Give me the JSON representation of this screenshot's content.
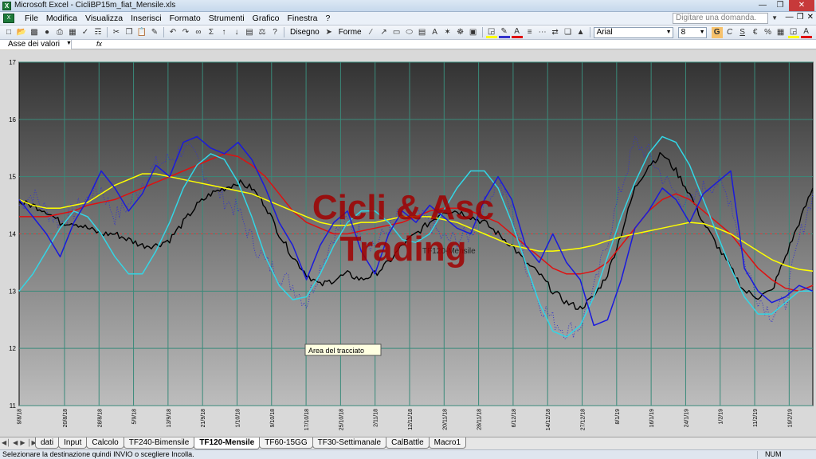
{
  "window": {
    "title": "Microsoft Excel - CicliBP15m_fiat_Mensile.xls"
  },
  "menu": [
    "File",
    "Modifica",
    "Visualizza",
    "Inserisci",
    "Formato",
    "Strumenti",
    "Grafico",
    "Finestra",
    "?"
  ],
  "help_box": {
    "placeholder": "Digitare una domanda."
  },
  "toolbar": {
    "draw_label": "Disegno",
    "shapes_label": "Forme",
    "font_name": "Arial",
    "font_size": "8"
  },
  "namebox": {
    "value": "Asse dei valori"
  },
  "formula": {
    "fx": "fx"
  },
  "chart": {
    "watermark_line1": "Cicli & Asc",
    "watermark_line2": "Trading",
    "tooltip": "Area del tracciato",
    "hidden_label": "TF120-Mensile",
    "reference_level": 14,
    "colors": {
      "price": "#000000",
      "dotted": "#3333cc",
      "red": "#e01010",
      "yellow": "#ffff00",
      "cyan": "#33d6e6",
      "blue": "#1a1adc",
      "watermark": "#a00000"
    }
  },
  "chart_data": {
    "type": "line",
    "ylim": [
      11,
      17
    ],
    "y_ticks": [
      "11",
      "12",
      "13",
      "14",
      "15",
      "16",
      "17"
    ],
    "x_ticks": [
      "9/8/18",
      "20/8/18",
      "28/8/18",
      "5/9/18",
      "13/9/18",
      "21/9/18",
      "1/10/18",
      "9/10/18",
      "17/10/18",
      "25/10/18",
      "2/11/18",
      "12/11/18",
      "20/11/18",
      "28/11/18",
      "6/12/18",
      "14/12/18",
      "27/12/18",
      "8/1/19",
      "16/1/19",
      "24/1/19",
      "1/2/19",
      "11/2/19",
      "19/2/19"
    ],
    "series": [
      {
        "values": [
          14.6,
          14.3,
          14.0,
          13.6,
          14.2,
          14.6,
          15.1,
          14.8,
          14.4,
          14.7,
          15.2,
          15.0,
          15.6,
          15.7,
          15.5,
          15.4,
          15.6,
          15.3,
          14.8,
          14.2,
          13.8,
          13.2,
          13.8,
          14.2,
          14.4,
          13.7,
          13.3,
          14.0,
          14.4,
          14.2,
          14.5,
          14.3,
          14.1,
          14.0,
          14.6,
          15.0,
          14.6,
          13.8,
          13.5,
          14.0,
          13.5,
          13.2,
          12.4,
          12.5,
          13.2,
          14.1,
          14.4,
          14.8,
          14.6,
          14.2,
          14.7,
          14.9,
          15.1,
          13.4,
          13.0,
          12.8,
          12.9,
          13.1,
          13.0
        ]
      },
      {
        "values": [
          14.5,
          14.7,
          14.4,
          14.2,
          14.4,
          14.6,
          14.8,
          14.3,
          14.5,
          14.9,
          15.2,
          15.3,
          15.5,
          15.3,
          14.9,
          14.6,
          14.4,
          13.9,
          13.5,
          13.3,
          13.1,
          12.8,
          13.4,
          14.0,
          14.2,
          14.0,
          13.8,
          14.1,
          14.4,
          14.3,
          14.2,
          13.9,
          13.9,
          14.0,
          14.5,
          14.9,
          14.4,
          13.5,
          12.8,
          12.5,
          12.3,
          12.4,
          13.0,
          13.9,
          14.8,
          15.6,
          15.4,
          15.0,
          14.7,
          14.5,
          14.8,
          14.9,
          14.6,
          13.5,
          12.9,
          12.6,
          12.8,
          13.9,
          14.7
        ]
      },
      {
        "values": [
          14.55,
          14.5,
          14.4,
          14.2,
          14.2,
          14.1,
          14.0,
          14.0,
          13.9,
          13.8,
          13.8,
          13.9,
          14.2,
          14.5,
          14.7,
          14.8,
          14.9,
          14.8,
          14.5,
          14.0,
          13.6,
          13.3,
          13.1,
          13.2,
          13.3,
          13.2,
          13.3,
          13.5,
          13.8,
          14.0,
          14.2,
          14.4,
          14.4,
          14.3,
          14.2,
          14.0,
          13.8,
          13.5,
          13.3,
          13.0,
          12.8,
          12.7,
          12.9,
          13.3,
          14.0,
          14.8,
          15.2,
          15.4,
          15.1,
          14.7,
          14.2,
          13.8,
          13.4,
          13.0,
          12.9,
          13.0,
          13.6,
          14.2,
          14.8
        ]
      },
      {
        "values": [
          14.3,
          14.3,
          14.3,
          14.35,
          14.4,
          14.5,
          14.55,
          14.6,
          14.7,
          14.8,
          14.9,
          15.0,
          15.1,
          15.2,
          15.3,
          15.4,
          15.35,
          15.2,
          15.0,
          14.7,
          14.4,
          14.2,
          14.1,
          14.0,
          14.0,
          14.05,
          14.1,
          14.15,
          14.2,
          14.3,
          14.4,
          14.45,
          14.45,
          14.4,
          14.3,
          14.2,
          14.0,
          13.8,
          13.6,
          13.4,
          13.3,
          13.3,
          13.35,
          13.5,
          13.8,
          14.1,
          14.4,
          14.6,
          14.7,
          14.6,
          14.4,
          14.2,
          14.0,
          13.7,
          13.4,
          13.2,
          13.05,
          13.0,
          13.1
        ]
      },
      {
        "values": [
          14.6,
          14.5,
          14.45,
          14.45,
          14.5,
          14.55,
          14.7,
          14.85,
          14.95,
          15.05,
          15.05,
          15.0,
          14.95,
          14.9,
          14.85,
          14.8,
          14.75,
          14.7,
          14.6,
          14.5,
          14.4,
          14.3,
          14.2,
          14.15,
          14.15,
          14.2,
          14.2,
          14.25,
          14.3,
          14.3,
          14.3,
          14.25,
          14.2,
          14.1,
          14.0,
          13.9,
          13.8,
          13.75,
          13.7,
          13.7,
          13.72,
          13.75,
          13.8,
          13.88,
          13.95,
          14.0,
          14.05,
          14.1,
          14.15,
          14.2,
          14.18,
          14.1,
          14.0,
          13.85,
          13.7,
          13.55,
          13.45,
          13.38,
          13.35
        ]
      },
      {
        "values": [
          13.0,
          13.3,
          13.7,
          14.1,
          14.4,
          14.3,
          14.0,
          13.6,
          13.3,
          13.3,
          13.7,
          14.2,
          14.8,
          15.2,
          15.4,
          15.3,
          14.9,
          14.3,
          13.6,
          13.1,
          12.85,
          12.9,
          13.3,
          13.8,
          14.2,
          14.4,
          14.4,
          14.2,
          13.9,
          13.85,
          14.0,
          14.4,
          14.8,
          15.1,
          15.1,
          14.8,
          14.2,
          13.5,
          12.8,
          12.3,
          12.2,
          12.4,
          12.9,
          13.6,
          14.3,
          14.9,
          15.4,
          15.7,
          15.6,
          15.2,
          14.6,
          14.0,
          13.4,
          12.9,
          12.6,
          12.6,
          12.8,
          13.0,
          13.0
        ]
      }
    ]
  }
}
